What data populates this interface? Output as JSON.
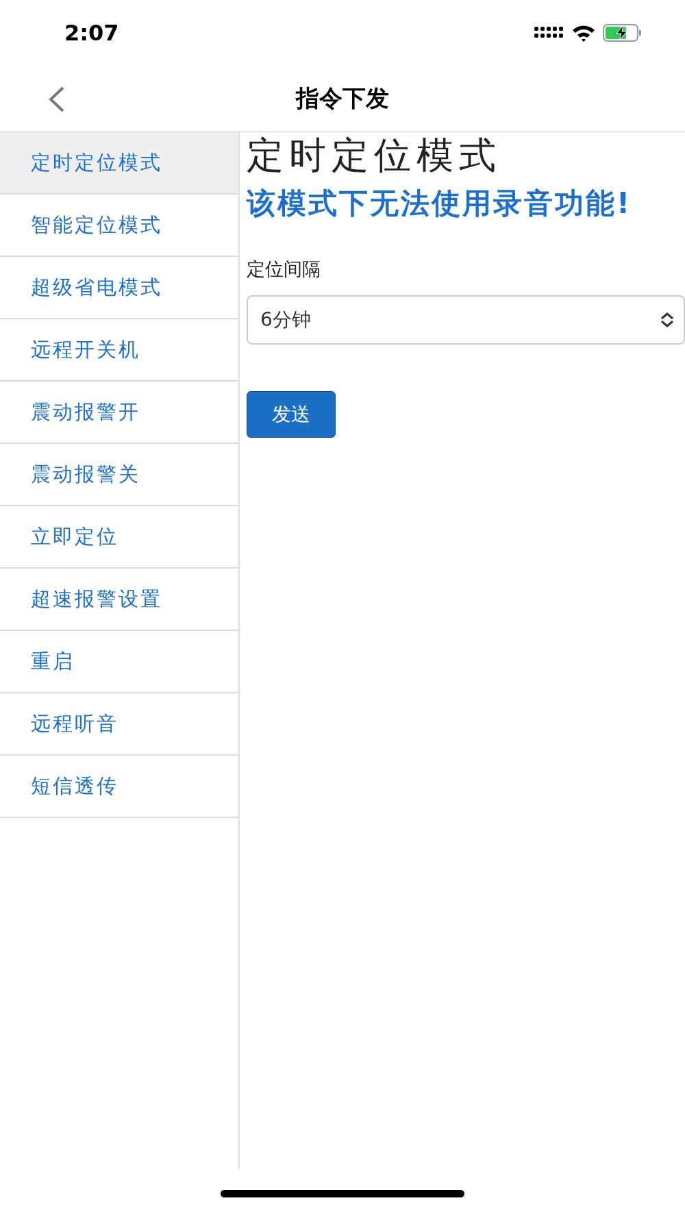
{
  "status_bar": {
    "time": "2:07"
  },
  "nav_bar": {
    "title": "指令下发"
  },
  "sidebar": {
    "items": [
      {
        "label": "定时定位模式",
        "selected": true
      },
      {
        "label": "智能定位模式",
        "selected": false
      },
      {
        "label": "超级省电模式",
        "selected": false
      },
      {
        "label": "远程开关机",
        "selected": false
      },
      {
        "label": "震动报警开",
        "selected": false
      },
      {
        "label": "震动报警关",
        "selected": false
      },
      {
        "label": "立即定位",
        "selected": false
      },
      {
        "label": "超速报警设置",
        "selected": false
      },
      {
        "label": "重启",
        "selected": false
      },
      {
        "label": "远程听音",
        "selected": false
      },
      {
        "label": "短信透传",
        "selected": false
      }
    ]
  },
  "content": {
    "title": "定时定位模式",
    "warning": "该模式下无法使用录音功能!",
    "interval_field": {
      "label": "定位间隔",
      "value": "6分钟"
    },
    "send_button": "发送"
  }
}
